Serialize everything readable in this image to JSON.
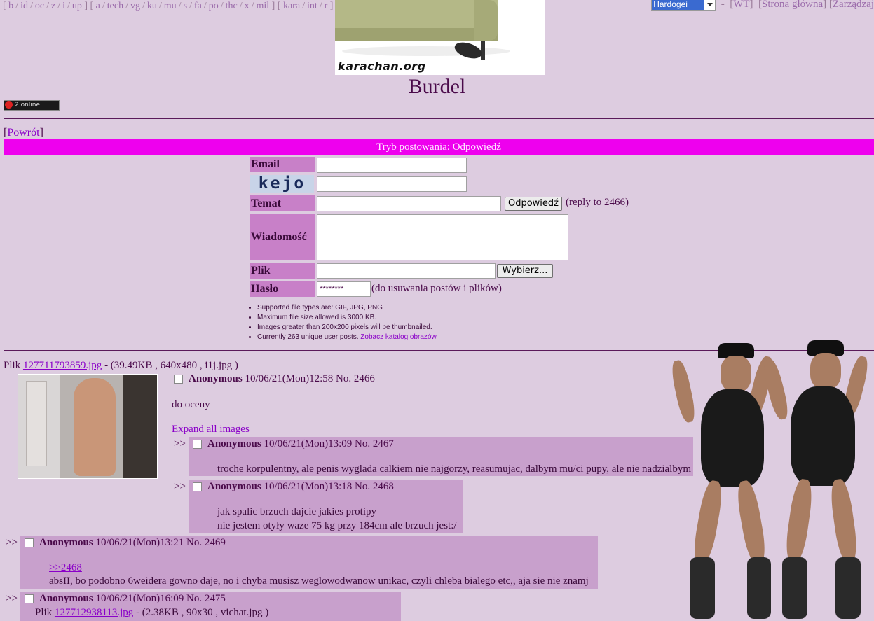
{
  "nav": {
    "group1": [
      "b",
      "id",
      "oc",
      "z",
      "i",
      "up"
    ],
    "group2": [
      "a",
      "tech",
      "vg",
      "ku",
      "mu",
      "s",
      "fa",
      "po",
      "thc",
      "x",
      "mil"
    ],
    "group3": [
      "kara",
      "int",
      "r"
    ],
    "style_select": "Hardogei",
    "links_right": [
      "WT",
      "Strona główna",
      "Zarządzaj"
    ]
  },
  "banner": {
    "logo_text": "karachan.org"
  },
  "board": {
    "title": "Burdel",
    "online_badge": "2 online"
  },
  "back_link": "Powrót",
  "posting_mode": "Tryb postowania: Odpowiedź",
  "form": {
    "email_label": "Email",
    "captcha_text": "kejo",
    "subject_label": "Temat",
    "submit_label": "Odpowiedź",
    "reply_to": "(reply to 2466)",
    "message_label": "Wiadomość",
    "file_label": "Plik",
    "browse_label": "Wybierz...",
    "password_label": "Hasło",
    "password_value": "********",
    "password_note": "(do usuwania postów i plików)"
  },
  "rules": {
    "items": [
      "Supported file types are: GIF, JPG, PNG",
      "Maximum file size allowed is 3000 KB.",
      "Images greater than 200x200 pixels will be thumbnailed."
    ],
    "last_prefix": "Currently 263 unique user posts.",
    "last_link": "Zobacz katalog obrazów"
  },
  "op": {
    "file_prefix": "Plik",
    "file_name": "127711793859.jpg",
    "file_meta": "- (39.49KB , 640x480 , i1j.jpg )",
    "name": "Anonymous",
    "date": "10/06/21(Mon)12:58 No. 2466",
    "message": "do oceny",
    "expand_link": "Expand all images"
  },
  "replies": [
    {
      "arrows": ">>",
      "name": "Anonymous",
      "date": "10/06/21(Mon)13:09 No. 2467",
      "lines": [
        "troche korpulentny, ale penis wyglada calkiem nie najgorzy, reasumujac, dalbym mu/ci pupy, ale nie nadzialbym"
      ]
    },
    {
      "arrows": ">>",
      "name": "Anonymous",
      "date": "10/06/21(Mon)13:18 No. 2468",
      "lines": [
        "jak spalic brzuch dajcie jakies protipy",
        "nie jestem otyły waze 75 kg przy 184cm ale brzuch jest:/"
      ]
    },
    {
      "arrows": ">>",
      "name": "Anonymous",
      "date": "10/06/21(Mon)13:21 No. 2469",
      "quote_link": ">>2468",
      "lines": [
        "absII, bo podobno 6weidera gowno daje, no i chyba musisz weglowodwanow unikac, czyli chleba bialego etc,, aja sie nie znamj"
      ]
    },
    {
      "arrows": ">>",
      "name": "Anonymous",
      "date": "10/06/21(Mon)16:09 No. 2475",
      "file_prefix": "Plik",
      "file_name": "127712938113.jpg",
      "file_meta": "- (2.38KB , 90x30 , vichat.jpg )"
    }
  ]
}
